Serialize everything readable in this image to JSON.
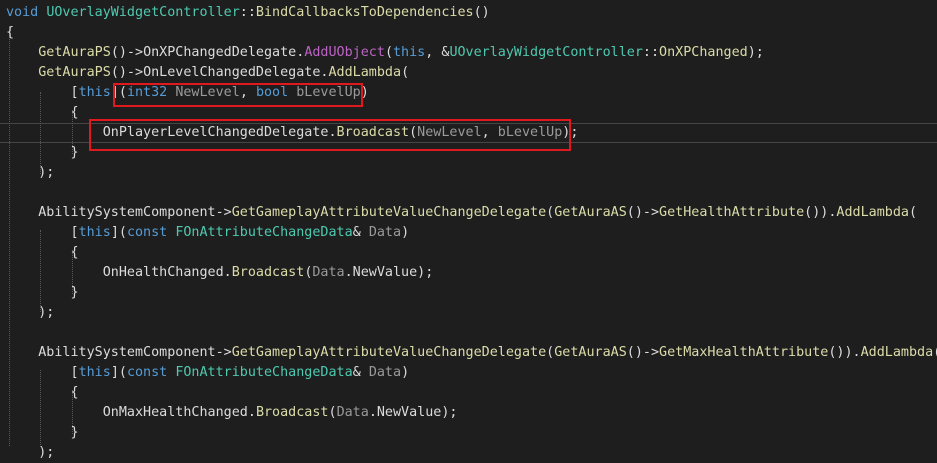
{
  "colors": {
    "background": "#1e1e1e",
    "keyword": "#569cd6",
    "type": "#4ec9b0",
    "function": "#dcdcaa",
    "macro": "#bd63c5",
    "parameter": "#9a9a9a",
    "plain": "#dcdcdc",
    "highlight_box": "#e0191f"
  },
  "lines": [
    [
      [
        "kw",
        "void "
      ],
      [
        "ty",
        "UOverlayWidgetController"
      ],
      [
        "pl",
        "::"
      ],
      [
        "fn",
        "BindCallbacksToDependencies"
      ],
      [
        "pl",
        "()"
      ]
    ],
    [
      [
        "pl",
        "{"
      ]
    ],
    [
      [
        "pl",
        "    "
      ],
      [
        "fn",
        "GetAuraPS"
      ],
      [
        "pl",
        "()->"
      ],
      [
        "pl",
        "OnXPChangedDelegate."
      ],
      [
        "mac",
        "AddUObject"
      ],
      [
        "pl",
        "("
      ],
      [
        "kw",
        "this"
      ],
      [
        "pl",
        ", &"
      ],
      [
        "ty",
        "UOverlayWidgetController"
      ],
      [
        "pl",
        "::"
      ],
      [
        "fn",
        "OnXPChanged"
      ],
      [
        "pl",
        ");"
      ]
    ],
    [
      [
        "pl",
        "    "
      ],
      [
        "fn",
        "GetAuraPS"
      ],
      [
        "pl",
        "()->"
      ],
      [
        "pl",
        "OnLevelChangedDelegate."
      ],
      [
        "fn",
        "AddLambda"
      ],
      [
        "pl",
        "("
      ]
    ],
    [
      [
        "pl",
        "        ["
      ],
      [
        "kw",
        "this"
      ],
      [
        "pl",
        "]("
      ],
      [
        "kw",
        "int32 "
      ],
      [
        "par",
        "NewLevel"
      ],
      [
        "pl",
        ", "
      ],
      [
        "kw",
        "bool "
      ],
      [
        "par",
        "bLevelUp"
      ],
      [
        "pl",
        ")"
      ]
    ],
    [
      [
        "pl",
        "        {"
      ]
    ],
    [
      [
        "pl",
        "            "
      ],
      [
        "pl",
        "OnPlayerLevelChangedDelegate."
      ],
      [
        "fn",
        "Broadcast"
      ],
      [
        "pl",
        "("
      ],
      [
        "par",
        "NewLevel"
      ],
      [
        "pl",
        ", "
      ],
      [
        "par",
        "bLevelUp"
      ],
      [
        "pl",
        ");"
      ]
    ],
    [
      [
        "pl",
        "        }"
      ]
    ],
    [
      [
        "pl",
        "    );"
      ]
    ],
    [],
    [
      [
        "pl",
        "    "
      ],
      [
        "pl",
        "AbilitySystemComponent->"
      ],
      [
        "fn",
        "GetGameplayAttributeValueChangeDelegate"
      ],
      [
        "pl",
        "("
      ],
      [
        "fn",
        "GetAuraAS"
      ],
      [
        "pl",
        "()->"
      ],
      [
        "fn",
        "GetHealthAttribute"
      ],
      [
        "pl",
        "())."
      ],
      [
        "fn",
        "AddLambda"
      ],
      [
        "pl",
        "("
      ]
    ],
    [
      [
        "pl",
        "        ["
      ],
      [
        "kw",
        "this"
      ],
      [
        "pl",
        "]("
      ],
      [
        "kw",
        "const "
      ],
      [
        "ty",
        "FOnAttributeChangeData"
      ],
      [
        "pl",
        "& "
      ],
      [
        "par",
        "Data"
      ],
      [
        "pl",
        ")"
      ]
    ],
    [
      [
        "pl",
        "        {"
      ]
    ],
    [
      [
        "pl",
        "            "
      ],
      [
        "pl",
        "OnHealthChanged."
      ],
      [
        "fn",
        "Broadcast"
      ],
      [
        "pl",
        "("
      ],
      [
        "par",
        "Data"
      ],
      [
        "pl",
        ".NewValue);"
      ]
    ],
    [
      [
        "pl",
        "        }"
      ]
    ],
    [
      [
        "pl",
        "    );"
      ]
    ],
    [],
    [
      [
        "pl",
        "    "
      ],
      [
        "pl",
        "AbilitySystemComponent->"
      ],
      [
        "fn",
        "GetGameplayAttributeValueChangeDelegate"
      ],
      [
        "pl",
        "("
      ],
      [
        "fn",
        "GetAuraAS"
      ],
      [
        "pl",
        "()->"
      ],
      [
        "fn",
        "GetMaxHealthAttribute"
      ],
      [
        "pl",
        "())."
      ],
      [
        "fn",
        "AddLambda"
      ],
      [
        "pl",
        "("
      ]
    ],
    [
      [
        "pl",
        "        ["
      ],
      [
        "kw",
        "this"
      ],
      [
        "pl",
        "]("
      ],
      [
        "kw",
        "const "
      ],
      [
        "ty",
        "FOnAttributeChangeData"
      ],
      [
        "pl",
        "& "
      ],
      [
        "par",
        "Data"
      ],
      [
        "pl",
        ")"
      ]
    ],
    [
      [
        "pl",
        "        {"
      ]
    ],
    [
      [
        "pl",
        "            "
      ],
      [
        "pl",
        "OnMaxHealthChanged."
      ],
      [
        "fn",
        "Broadcast"
      ],
      [
        "pl",
        "("
      ],
      [
        "par",
        "Data"
      ],
      [
        "pl",
        ".NewValue);"
      ]
    ],
    [
      [
        "pl",
        "        }"
      ]
    ],
    [
      [
        "pl",
        "    );"
      ]
    ]
  ]
}
